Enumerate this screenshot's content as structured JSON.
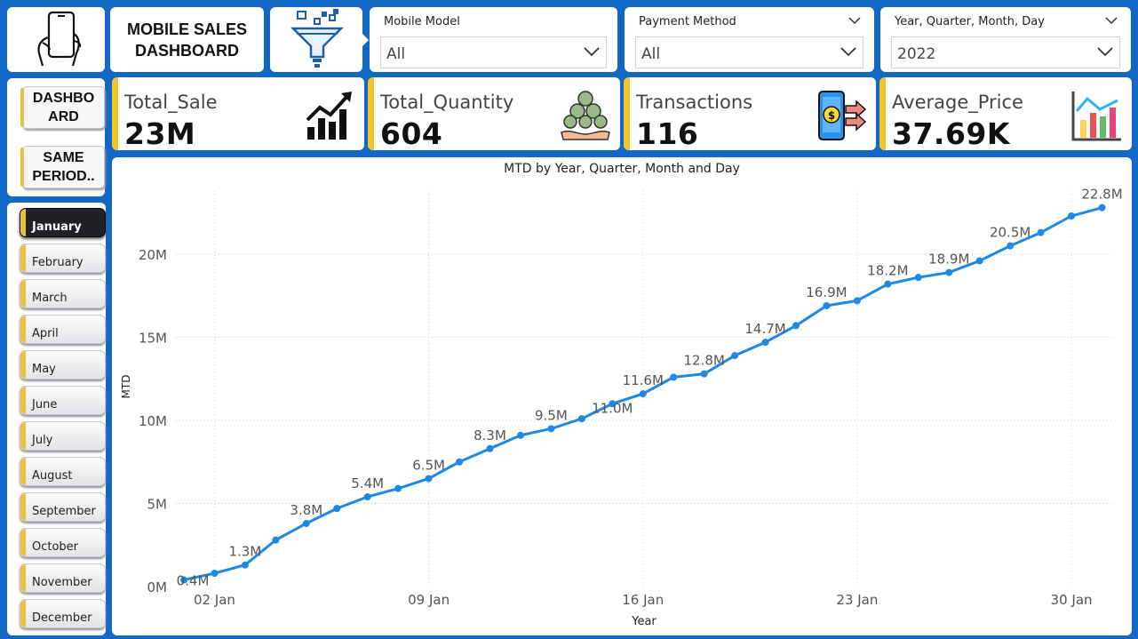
{
  "header": {
    "title": "MOBILE SALES DASHBOARD"
  },
  "filters": {
    "mobile_model": {
      "label": "Mobile Model",
      "value": "All"
    },
    "payment_method": {
      "label": "Payment Method",
      "value": "All"
    },
    "date_hierarchy": {
      "label": "Year, Quarter, Month, Day",
      "value": "2022"
    }
  },
  "kpis": [
    {
      "label": "Total_Sale",
      "value": "23M",
      "icon": "growth-chart-icon"
    },
    {
      "label": "Total_Quantity",
      "value": "604",
      "icon": "coins-hand-icon"
    },
    {
      "label": "Transactions",
      "value": "116",
      "icon": "phone-payment-icon"
    },
    {
      "label": "Average_Price",
      "value": "37.69K",
      "icon": "bar-chart-icon"
    }
  ],
  "nav": {
    "dashboard": "DASHBOARD",
    "same_period": "SAME PERIOD.."
  },
  "months": [
    "January",
    "February",
    "March",
    "April",
    "May",
    "June",
    "July",
    "August",
    "September",
    "October",
    "November",
    "December"
  ],
  "selected_month": "January",
  "colors": {
    "background": "#1368c6",
    "accent": "#f1c72c",
    "line": "#1e88e5"
  },
  "chart_data": {
    "type": "line",
    "title": "MTD by Year, Quarter, Month and Day",
    "xlabel": "Year",
    "ylabel": "MTD",
    "x_ticks": [
      "02 Jan",
      "09 Jan",
      "16 Jan",
      "23 Jan",
      "30 Jan"
    ],
    "y_ticks": [
      "0M",
      "5M",
      "10M",
      "15M",
      "20M"
    ],
    "ylim": [
      0,
      24
    ],
    "grid": true,
    "series": [
      {
        "x": [
          "01 Jan",
          "02 Jan",
          "03 Jan",
          "04 Jan",
          "05 Jan",
          "06 Jan",
          "07 Jan",
          "08 Jan",
          "09 Jan",
          "10 Jan",
          "11 Jan",
          "12 Jan",
          "13 Jan",
          "14 Jan",
          "15 Jan",
          "16 Jan",
          "17 Jan",
          "18 Jan",
          "19 Jan",
          "20 Jan",
          "21 Jan",
          "22 Jan",
          "23 Jan",
          "24 Jan",
          "25 Jan",
          "26 Jan",
          "27 Jan",
          "28 Jan",
          "29 Jan",
          "30 Jan",
          "31 Jan"
        ],
        "values": [
          0.4,
          0.8,
          1.3,
          2.8,
          3.8,
          4.7,
          5.4,
          5.9,
          6.5,
          7.5,
          8.3,
          9.1,
          9.5,
          10.1,
          11.0,
          11.6,
          12.6,
          12.8,
          13.9,
          14.7,
          15.7,
          16.9,
          17.2,
          18.2,
          18.6,
          18.9,
          19.6,
          20.5,
          21.3,
          22.3,
          22.8
        ],
        "labels": [
          "0.4M",
          "",
          "1.3M",
          "",
          "3.8M",
          "",
          "5.4M",
          "",
          "6.5M",
          "",
          "8.3M",
          "",
          "9.5M",
          "",
          "11.0M",
          "11.6M",
          "",
          "12.8M",
          "",
          "14.7M",
          "",
          "16.9M",
          "",
          "18.2M",
          "",
          "18.9M",
          "",
          "20.5M",
          "",
          "",
          "22.8M"
        ]
      }
    ]
  }
}
